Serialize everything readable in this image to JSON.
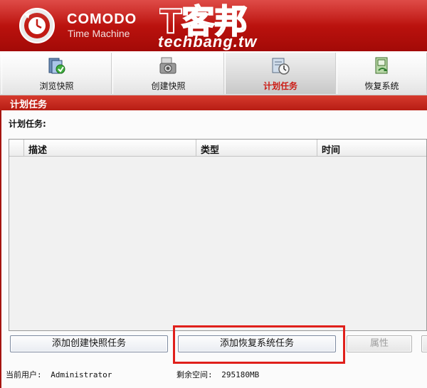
{
  "header": {
    "brand": "COMODO",
    "product": "Time Machine",
    "watermark_cn": "T客邦",
    "watermark_en": "techbang.tw",
    "bg_color": "#b8110d"
  },
  "tabs": [
    {
      "label": "浏览快照",
      "icon": "browse-snapshot-icon",
      "active": false
    },
    {
      "label": "创建快照",
      "icon": "camera-icon",
      "active": false
    },
    {
      "label": "计划任务",
      "icon": "clock-icon",
      "active": true
    },
    {
      "label": "恢复系统",
      "icon": "restore-system-icon",
      "active": false
    }
  ],
  "section_title": "计划任务",
  "task_label": "计划任务:",
  "table": {
    "columns": [
      "描述",
      "类型",
      "时间"
    ],
    "rows": []
  },
  "buttons": {
    "add_snapshot_task": "添加创建快照任务",
    "add_restore_task": "添加恢复系统任务",
    "properties": "属性"
  },
  "status": {
    "current_user_label": "当前用户:",
    "current_user": "Administrator",
    "free_space_label": "剩余空间:",
    "free_space": "295180MB"
  },
  "colors": {
    "accent_red": "#c8170f",
    "highlight_red": "#e0201b"
  }
}
